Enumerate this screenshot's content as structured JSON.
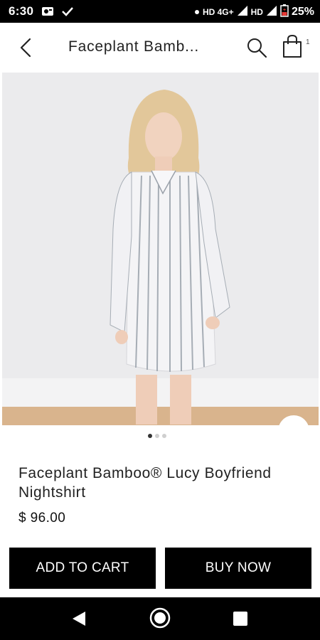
{
  "status_bar": {
    "time": "6:30",
    "network_label": "HD 4G+",
    "second_network_label": "HD",
    "battery": "25%",
    "icons": [
      "photo-notification-icon",
      "check-icon",
      "dot-icon",
      "signal-icon",
      "signal-icon-2",
      "battery-icon"
    ]
  },
  "app_bar": {
    "title": "Faceplant Bamb...",
    "cart_count": "1",
    "icons": [
      "back-arrow-icon",
      "search-icon",
      "shopping-bag-icon"
    ]
  },
  "product": {
    "name": "Faceplant Bamboo® Lucy Boyfriend Nightshirt",
    "price": "$ 96.00",
    "image_count": 3,
    "active_image": 1
  },
  "actions": {
    "add_to_cart": "ADD TO CART",
    "buy_now": "BUY NOW"
  },
  "nav_bar": {
    "icons": [
      "nav-back-icon",
      "nav-home-icon",
      "nav-recent-icon"
    ]
  },
  "colors": {
    "primary": "#000000",
    "background": "#ffffff",
    "text": "#222222",
    "photo_background": "#e9e9eb"
  }
}
